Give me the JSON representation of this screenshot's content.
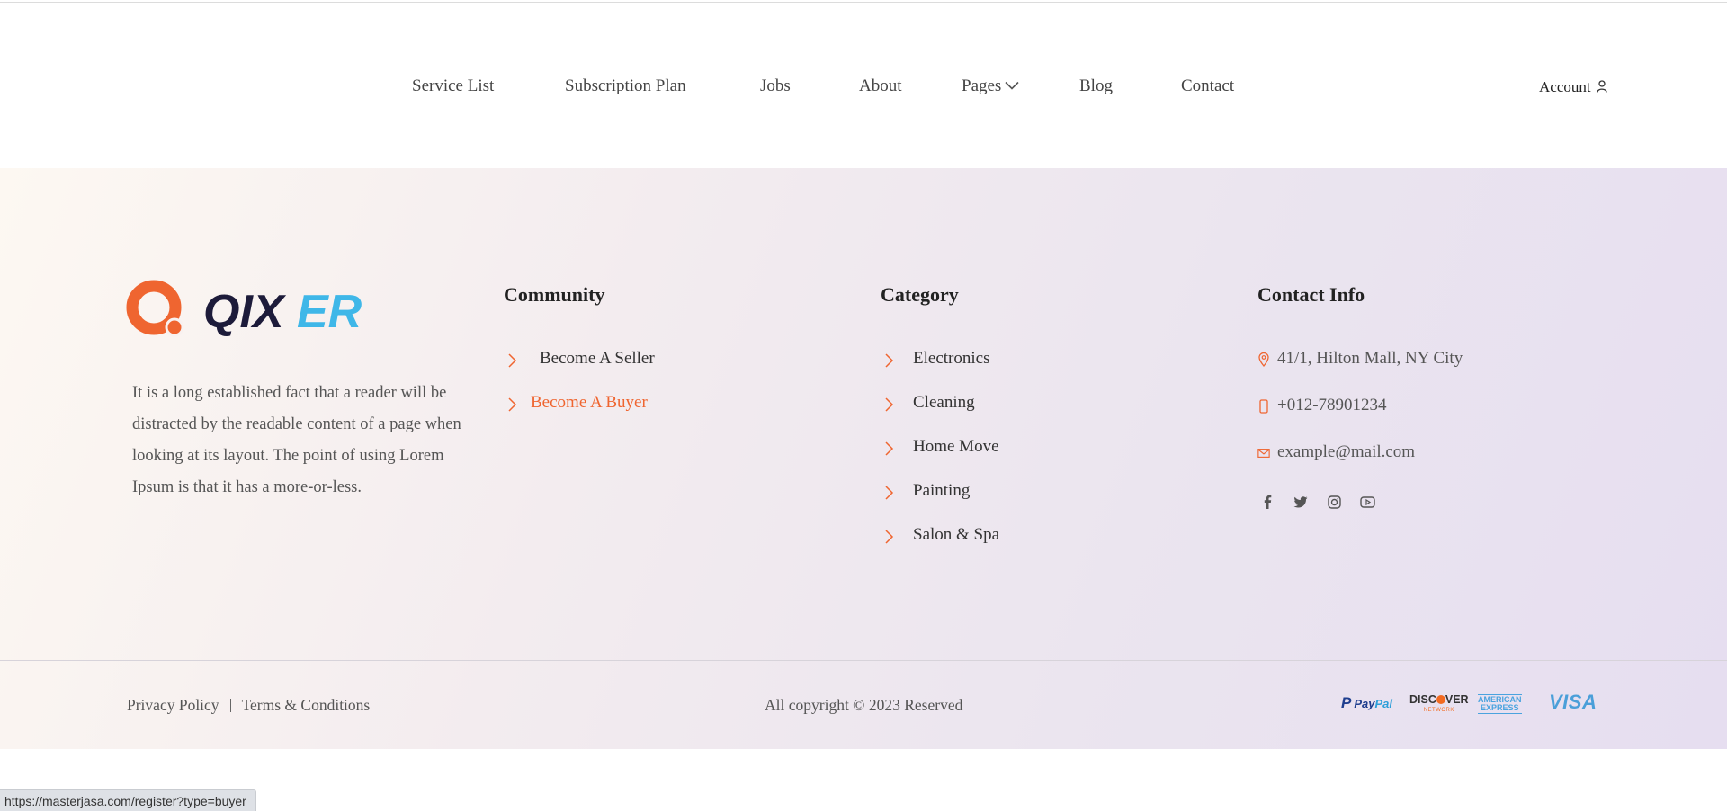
{
  "nav": {
    "items": [
      {
        "label": "Service List"
      },
      {
        "label": "Subscription Plan"
      },
      {
        "label": "Jobs"
      },
      {
        "label": "About"
      },
      {
        "label": "Pages",
        "icon": "chevron-down-icon"
      },
      {
        "label": "Blog"
      },
      {
        "label": "Contact"
      }
    ],
    "account_label": "Account",
    "account_icon": "user-icon"
  },
  "footer": {
    "logo_text": "QIXER",
    "about_text": "It is a long established fact that a reader will be distracted by the readable content of a page when looking at its layout. The point of using Lorem Ipsum is that it has a more-or-less.",
    "community": {
      "title": "Community",
      "links": [
        {
          "label": "Become A Seller"
        },
        {
          "label": "Become A Buyer",
          "state": "hover"
        }
      ]
    },
    "category": {
      "title": "Category",
      "links": [
        {
          "label": "Electronics"
        },
        {
          "label": "Cleaning"
        },
        {
          "label": "Home Move"
        },
        {
          "label": "Painting"
        },
        {
          "label": "Salon & Spa"
        }
      ]
    },
    "contact": {
      "title": "Contact Info",
      "address": "41/1, Hilton Mall, NY City",
      "phone": "+012-78901234",
      "email": "example@mail.com",
      "social": [
        "facebook-icon",
        "twitter-icon",
        "instagram-icon",
        "youtube-icon"
      ]
    },
    "bottom": {
      "privacy": "Privacy Policy",
      "terms": "Terms & Conditions",
      "copyright": "All copyright © 2023 Reserved",
      "payments": {
        "paypal": [
          "Pay",
          "Pal"
        ],
        "discover": [
          "DISC",
          "VER",
          "NETWORK"
        ],
        "amex": [
          "AMERICAN",
          "EXPRESS"
        ],
        "visa": "VISA"
      }
    }
  },
  "status_bar": {
    "url": "https://masterjasa.com/register?type=buyer"
  },
  "colors": {
    "accent": "#ef6530",
    "logo_dark": "#1d1b3a",
    "logo_blue": "#3fb7e8"
  }
}
